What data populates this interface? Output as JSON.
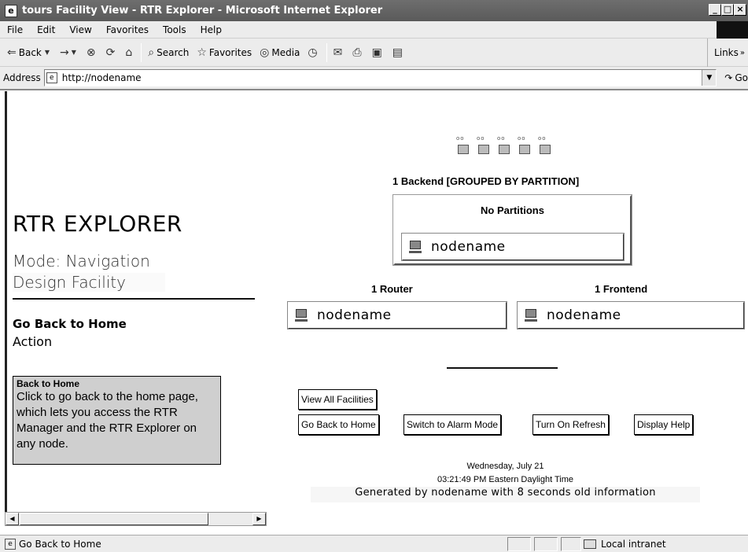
{
  "window": {
    "title": "tours Facility View - RTR Explorer - Microsoft Internet Explorer",
    "controls": {
      "minimize": "_",
      "maximize": "□",
      "close": "×"
    }
  },
  "menu": [
    "File",
    "Edit",
    "View",
    "Favorites",
    "Tools",
    "Help"
  ],
  "toolbar": {
    "back": "Back",
    "forward": "→",
    "search": "Search",
    "favorites": "Favorites",
    "media": "Media",
    "links": "Links"
  },
  "address": {
    "label": "Address",
    "url": "http://nodename",
    "go": "Go"
  },
  "explorer": {
    "title": "RTR EXPLORER",
    "mode": "Mode:  Navigation",
    "facility": "Design Facility",
    "home_link": "Go Back to Home",
    "action_label": "Action",
    "help_title": "Back to Home",
    "help_text": "Click to go back to the home page, which lets you access the RTR Manager and the RTR Explorer on any node."
  },
  "facility": {
    "backend_title": "1 Backend [GROUPED BY PARTITION]",
    "partition_title": "No Partitions",
    "backend_node": "nodename",
    "router_title": "1 Router",
    "router_node": "nodename",
    "frontend_title": "1 Frontend",
    "frontend_node": "nodename"
  },
  "buttons": {
    "view_all": "View All Facilities",
    "go_home": "Go Back to Home",
    "alarm_mode": "Switch to Alarm Mode",
    "refresh": "Turn On Refresh",
    "help": "Display Help"
  },
  "footer": {
    "date": "Wednesday, July 21",
    "time": "03:21:49 PM Eastern Daylight Time",
    "generated": "Generated by nodename with 8 seconds old information"
  },
  "status": {
    "text": "Go Back to Home",
    "zone": "Local intranet"
  }
}
